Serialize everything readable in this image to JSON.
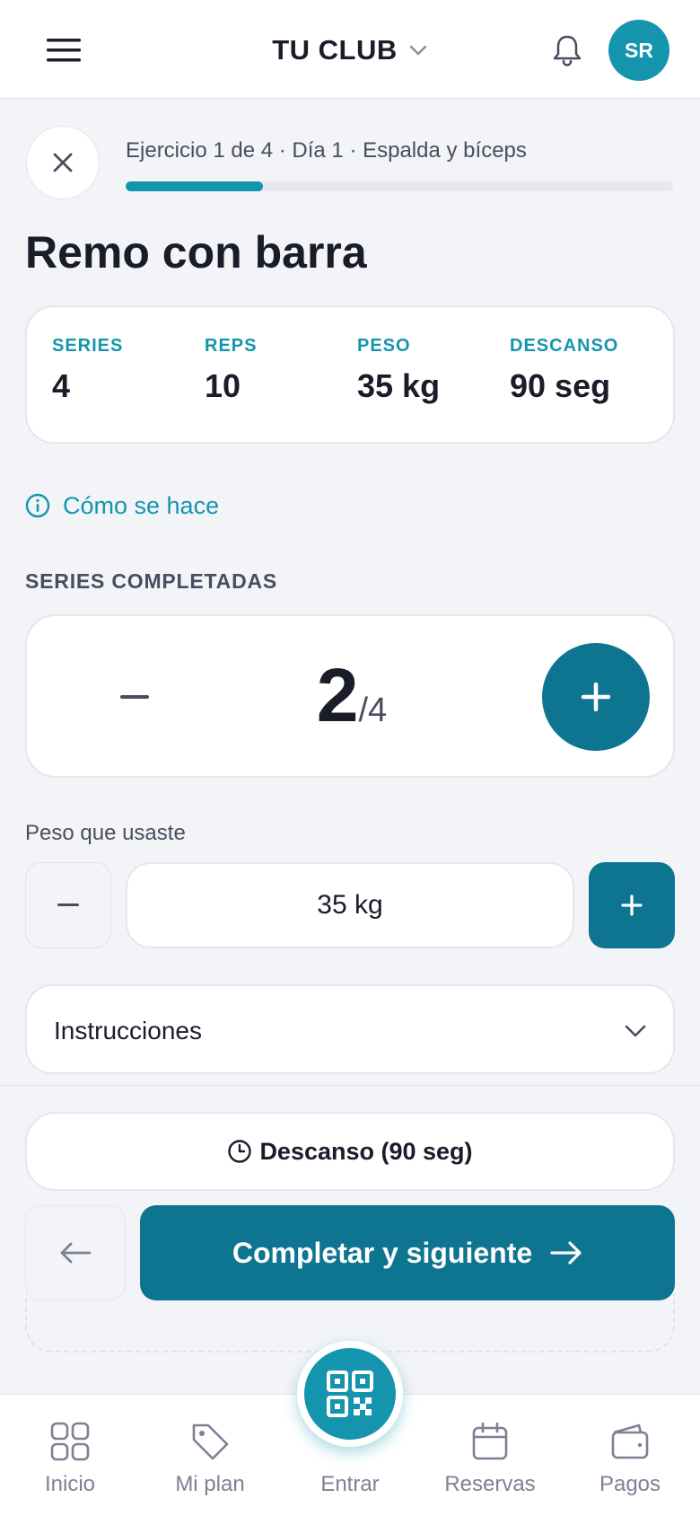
{
  "header": {
    "club_name": "TU CLUB",
    "avatar_initials": "SR"
  },
  "progress": {
    "text": "Ejercicio 1 de 4 · Día 1 · Espalda y bíceps",
    "fraction": 0.25
  },
  "exercise": {
    "title": "Remo con barra",
    "stats": [
      {
        "label": "SERIES",
        "value": "4"
      },
      {
        "label": "REPS",
        "value": "10"
      },
      {
        "label": "PESO",
        "value": "35 kg"
      },
      {
        "label": "DESCANSO",
        "value": "90 seg"
      }
    ]
  },
  "how_to": {
    "label": "Cómo se hace"
  },
  "sets": {
    "section_label": "SERIES COMPLETADAS",
    "completed": "2",
    "total": "/4"
  },
  "weight": {
    "label": "Peso que usaste",
    "value": "35 kg"
  },
  "instructions": {
    "label": "Instrucciones"
  },
  "actions": {
    "rest_label": "Descanso (90 seg)",
    "next_label": "Completar y siguiente"
  },
  "nav": {
    "items": [
      {
        "label": "Inicio",
        "icon": "grid-icon"
      },
      {
        "label": "Mi plan",
        "icon": "tag-icon"
      },
      {
        "label": "Entrar",
        "icon": "qr-code-icon"
      },
      {
        "label": "Reservas",
        "icon": "calendar-icon"
      },
      {
        "label": "Pagos",
        "icon": "wallet-icon"
      }
    ]
  },
  "colors": {
    "accent": "#1495ad",
    "accent_dark": "#0e7591",
    "text": "#1b1c2a",
    "muted": "#4a4d60",
    "background": "#f3f4f7"
  }
}
